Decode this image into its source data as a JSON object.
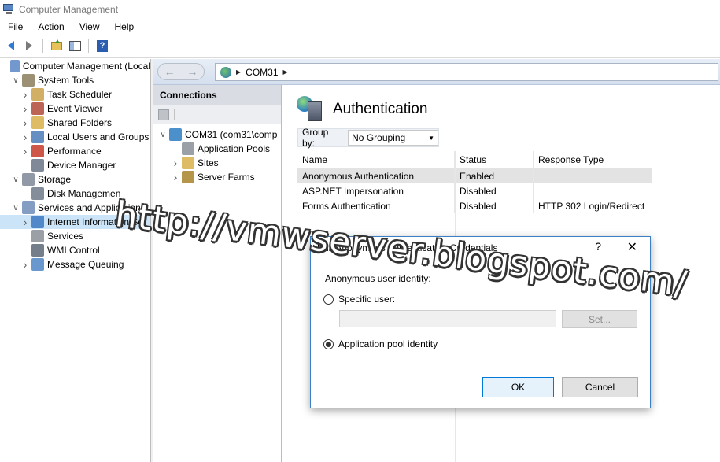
{
  "window": {
    "title": "Computer Management"
  },
  "menu": [
    "File",
    "Action",
    "View",
    "Help"
  ],
  "tree": [
    {
      "label": "Computer Management (Local",
      "level": 0,
      "expand": "",
      "icon": "computer-management-icon",
      "color": "#5b86c5"
    },
    {
      "label": "System Tools",
      "level": 1,
      "expand": "down",
      "icon": "tools-icon",
      "color": "#8a7d5a"
    },
    {
      "label": "Task Scheduler",
      "level": 2,
      "expand": "right",
      "icon": "clock-icon",
      "color": "#c9a24a"
    },
    {
      "label": "Event Viewer",
      "level": 2,
      "expand": "right",
      "icon": "event-viewer-icon",
      "color": "#b04a3a"
    },
    {
      "label": "Shared Folders",
      "level": 2,
      "expand": "right",
      "icon": "shared-folder-icon",
      "color": "#d8b04a"
    },
    {
      "label": "Local Users and Groups",
      "level": 2,
      "expand": "right",
      "icon": "users-icon",
      "color": "#4a7ab8"
    },
    {
      "label": "Performance",
      "level": 2,
      "expand": "right",
      "icon": "no-entry-icon",
      "color": "#c63a2a"
    },
    {
      "label": "Device Manager",
      "level": 2,
      "expand": "",
      "icon": "device-manager-icon",
      "color": "#6a7486"
    },
    {
      "label": "Storage",
      "level": 1,
      "expand": "down",
      "icon": "storage-icon",
      "color": "#7e8796"
    },
    {
      "label": "Disk Managemen",
      "level": 2,
      "expand": "",
      "icon": "disk-icon",
      "color": "#6e7a8a"
    },
    {
      "label": "Services and Applica ion",
      "level": 1,
      "expand": "down",
      "icon": "services-apps-icon",
      "color": "#6e8cb8"
    },
    {
      "label": "Internet Information Se",
      "level": 2,
      "expand": "right",
      "icon": "iis-icon",
      "color": "#3b78c2",
      "selected": true
    },
    {
      "label": "Services",
      "level": 2,
      "expand": "",
      "icon": "services-gear-icon",
      "color": "#8a8f96"
    },
    {
      "label": "WMI Control",
      "level": 2,
      "expand": "",
      "icon": "wmi-icon",
      "color": "#5b6775"
    },
    {
      "label": "Message Queuing",
      "level": 2,
      "expand": "right",
      "icon": "message-queue-icon",
      "color": "#4f86c6"
    }
  ],
  "address": {
    "crumb": "COM31"
  },
  "connections": {
    "header": "Connections",
    "items": [
      {
        "label": "COM31 (com31\\comp",
        "level": 0,
        "expand": "down",
        "icon": "server-globe-icon",
        "color": "#2b7dc2"
      },
      {
        "label": "Application Pools",
        "level": 1,
        "expand": "",
        "icon": "app-pools-icon",
        "color": "#8a8f96"
      },
      {
        "label": "Sites",
        "level": 1,
        "expand": "right",
        "icon": "sites-icon",
        "color": "#d8b04a"
      },
      {
        "label": "Server Farms",
        "level": 1,
        "expand": "right",
        "icon": "server-farms-icon",
        "color": "#a7832a"
      }
    ]
  },
  "feature": {
    "title": "Authentication",
    "groupby_label": "Group by:",
    "groupby_value": "No Grouping",
    "columns": [
      "Name",
      "Status",
      "Response Type"
    ],
    "rows": [
      {
        "name": "Anonymous Authentication",
        "status": "Enabled",
        "response": ""
      },
      {
        "name": "ASP.NET Impersonation",
        "status": "Disabled",
        "response": ""
      },
      {
        "name": "Forms Authentication",
        "status": "Disabled",
        "response": "HTTP 302 Login/Redirect"
      }
    ]
  },
  "dialog": {
    "title": "Edit Anonymous Authentication Credentials",
    "help_glyph": "?",
    "close_glyph": "✕",
    "identity_label": "Anonymous user identity:",
    "specific_user_label": "Specific user:",
    "specific_user_value": "",
    "set_button": "Set...",
    "app_pool_label": "Application pool identity",
    "selected_option": "Application pool identity",
    "ok_button": "OK",
    "cancel_button": "Cancel"
  },
  "watermark": "http://vmwserver.blogspot.com/"
}
